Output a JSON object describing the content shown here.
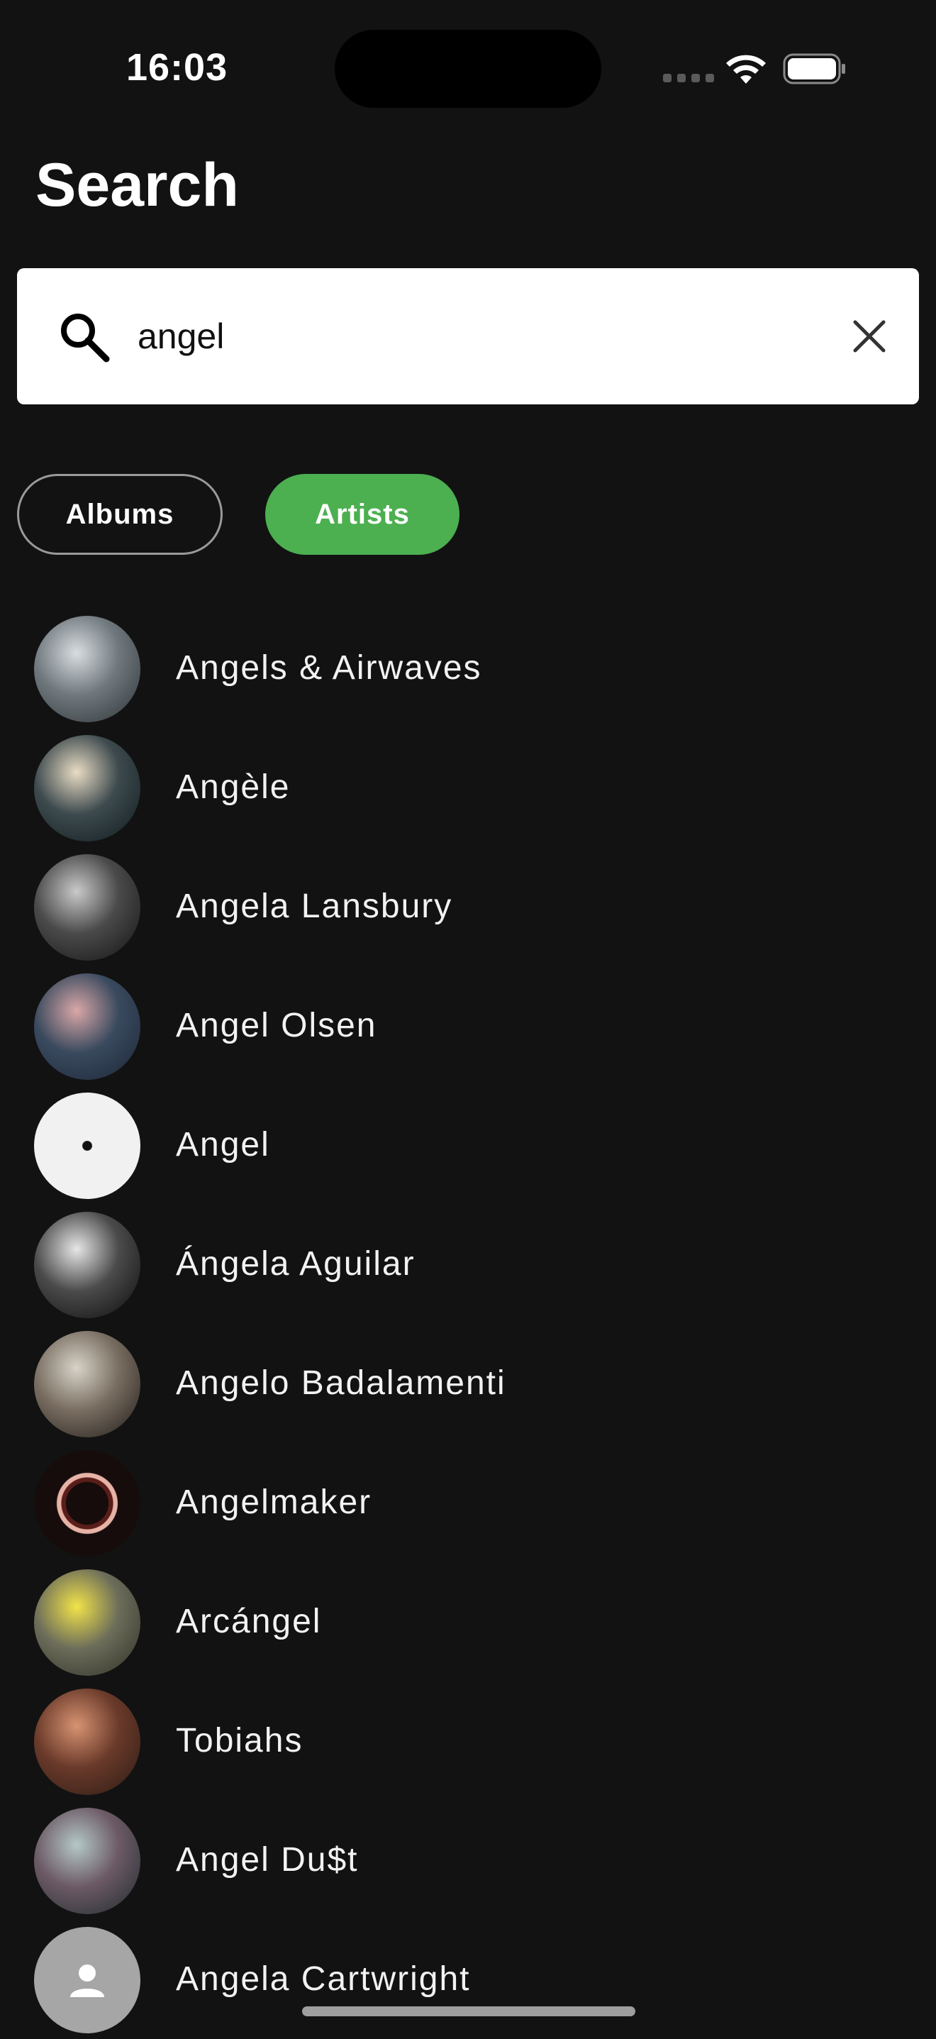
{
  "status_bar": {
    "time": "16:03"
  },
  "page": {
    "title": "Search"
  },
  "search": {
    "value": "angel",
    "icon": "search-icon",
    "clear_icon": "close-icon"
  },
  "filters": {
    "albums_label": "Albums",
    "artists_label": "Artists",
    "selected": "Artists",
    "accent_color": "#4caf50"
  },
  "artists": [
    {
      "name": "Angels & Airwaves",
      "avatar": "photo",
      "colors": [
        "#d8dde0",
        "#6f787d",
        "#2d3236"
      ]
    },
    {
      "name": "Angèle",
      "avatar": "photo",
      "colors": [
        "#e9dcc4",
        "#3d4a4e",
        "#0f1a1c"
      ]
    },
    {
      "name": "Angela Lansbury",
      "avatar": "photo",
      "colors": [
        "#c9c9c9",
        "#4a4a4a",
        "#121212"
      ]
    },
    {
      "name": "Angel Olsen",
      "avatar": "photo",
      "colors": [
        "#d9a7a8",
        "#3a4a5e",
        "#1b2537"
      ]
    },
    {
      "name": "Angel",
      "avatar": "vinyl-record",
      "colors": [
        "#f1f1f1",
        "#e4e4e4",
        "#111111"
      ]
    },
    {
      "name": "Ángela Aguilar",
      "avatar": "photo",
      "colors": [
        "#e6e6e6",
        "#4b4b4b",
        "#0b0b0b"
      ]
    },
    {
      "name": "Angelo Badalamenti",
      "avatar": "photo",
      "colors": [
        "#d7d3c8",
        "#7a6e62",
        "#1d1a17"
      ]
    },
    {
      "name": "Angelmaker",
      "avatar": "emblem",
      "colors": [
        "#e7b3a6",
        "#5a1e1a",
        "#160c0c"
      ]
    },
    {
      "name": "Arcángel",
      "avatar": "photo",
      "colors": [
        "#f2e34a",
        "#6c6d5a",
        "#2e2e26"
      ]
    },
    {
      "name": "Tobiahs",
      "avatar": "photo",
      "colors": [
        "#d79372",
        "#6a3a2a",
        "#2a1a14"
      ]
    },
    {
      "name": "Angel Du$t",
      "avatar": "photo",
      "colors": [
        "#b5c8c6",
        "#6c5a66",
        "#1f2a2c"
      ]
    },
    {
      "name": "Angela Cartwright",
      "avatar": "placeholder-person",
      "colors": [
        "#a6a6a6",
        "#a6a6a6",
        "#a6a6a6"
      ]
    }
  ]
}
